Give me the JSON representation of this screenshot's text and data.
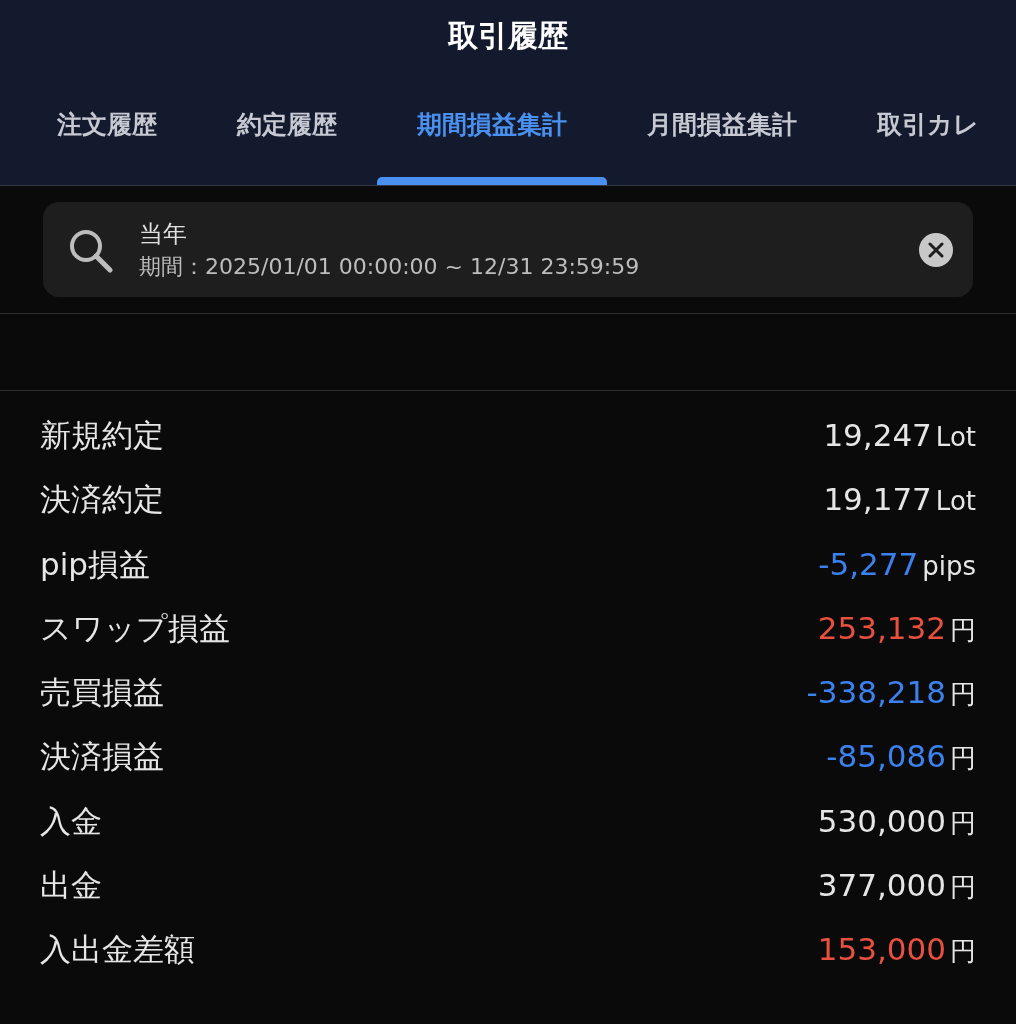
{
  "header": {
    "title": "取引履歴"
  },
  "tabs": [
    {
      "label": "注文履歴",
      "selected": false
    },
    {
      "label": "約定履歴",
      "selected": false
    },
    {
      "label": "期間損益集計",
      "selected": true
    },
    {
      "label": "月間損益集計",
      "selected": false
    },
    {
      "label": "取引カレ",
      "selected": false
    }
  ],
  "search": {
    "title": "当年",
    "period": "期間：2025/01/01 00:00:00 ~ 12/31 23:59:59"
  },
  "summary": [
    {
      "label": "新規約定",
      "value": "19,247",
      "unit": "Lot",
      "color": "#e6e6e6"
    },
    {
      "label": "決済約定",
      "value": "19,177",
      "unit": "Lot",
      "color": "#e6e6e6"
    },
    {
      "label": "pip損益",
      "value": "-5,277",
      "unit": "pips",
      "color": "#3b82f0"
    },
    {
      "label": "スワップ損益",
      "value": "253,132",
      "unit": "円",
      "color": "#e8503f"
    },
    {
      "label": "売買損益",
      "value": "-338,218",
      "unit": "円",
      "color": "#3b82f0"
    },
    {
      "label": "決済損益",
      "value": "-85,086",
      "unit": "円",
      "color": "#3b82f0"
    },
    {
      "label": "入金",
      "value": "530,000",
      "unit": "円",
      "color": "#e6e6e6"
    },
    {
      "label": "出金",
      "value": "377,000",
      "unit": "円",
      "color": "#e6e6e6"
    },
    {
      "label": "入出金差額",
      "value": "153,000",
      "unit": "円",
      "color": "#e8503f"
    }
  ]
}
